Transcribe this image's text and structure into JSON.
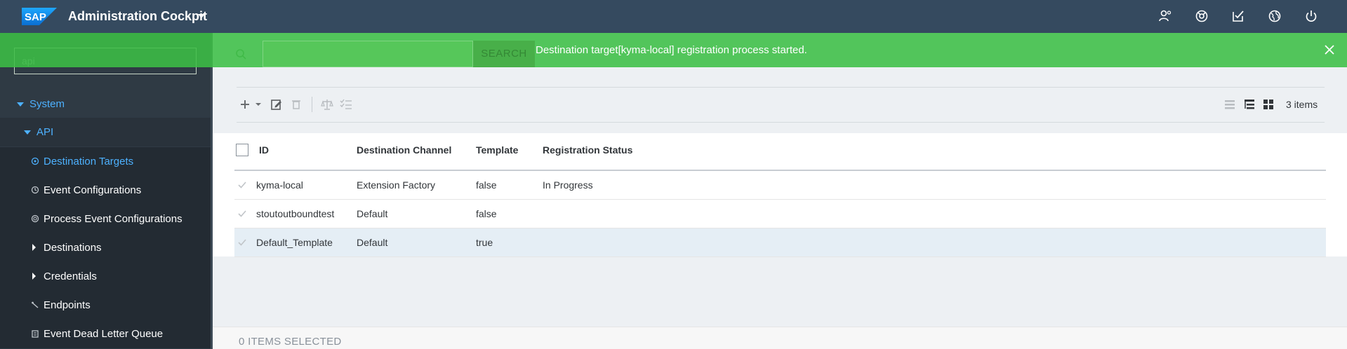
{
  "header": {
    "logo_text": "SAP",
    "app_title": "Administration Cockpit",
    "icons": [
      "user-settings-icon",
      "help-icon",
      "tasks-icon",
      "globe-icon",
      "power-icon"
    ]
  },
  "sidebar": {
    "search_value": "api",
    "tree": {
      "system": "System",
      "api": "API",
      "items": [
        {
          "label": "Destination Targets",
          "icon": "target-icon",
          "active": true
        },
        {
          "label": "Event Configurations",
          "icon": "event-icon"
        },
        {
          "label": "Process Event Configurations",
          "icon": "process-event-icon"
        },
        {
          "label": "Destinations",
          "icon": "expand-caret"
        },
        {
          "label": "Credentials",
          "icon": "expand-caret"
        },
        {
          "label": "Endpoints",
          "icon": "endpoint-icon"
        },
        {
          "label": "Event Dead Letter Queue",
          "icon": "queue-icon"
        }
      ]
    }
  },
  "notification": {
    "message": "Destination target[kyma-local] registration process started."
  },
  "search": {
    "button_label": "SEARCH"
  },
  "toolbar": {
    "items_count": "3 items"
  },
  "table": {
    "columns": [
      "ID",
      "Destination Channel",
      "Template",
      "Registration Status"
    ],
    "rows": [
      {
        "id": "kyma-local",
        "channel": "Extension Factory",
        "template": "false",
        "status": "In Progress"
      },
      {
        "id": "stoutoutboundtest",
        "channel": "Default",
        "template": "false",
        "status": ""
      },
      {
        "id": "Default_Template",
        "channel": "Default",
        "template": "true",
        "status": ""
      }
    ]
  },
  "footer": {
    "selected_text": "0 ITEMS SELECTED"
  },
  "colors": {
    "header": "#354a5f",
    "sidebar": "#2f3a44",
    "accent": "#4db1ff",
    "notification": "#3cbe46"
  }
}
